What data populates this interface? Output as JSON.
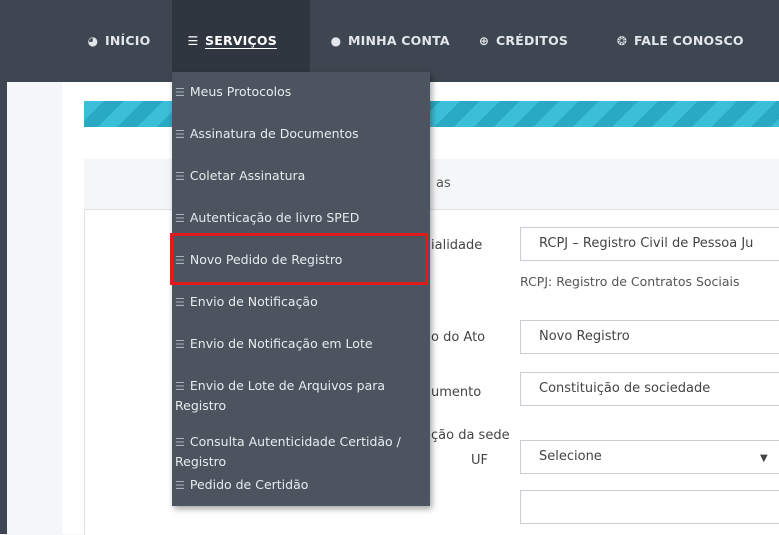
{
  "nav": {
    "items": [
      {
        "label": "INÍCIO",
        "icon": "tachometer-icon"
      },
      {
        "label": "SERVIÇOS",
        "icon": "layers-icon"
      },
      {
        "label": "MINHA CONTA",
        "icon": "user-icon"
      },
      {
        "label": "CRÉDITOS",
        "icon": "plus-circle-icon"
      },
      {
        "label": "FALE CONOSCO",
        "icon": "support-icon"
      }
    ]
  },
  "menu": {
    "items": [
      {
        "label": "Meus Protocolos"
      },
      {
        "label": "Assinatura de Documentos"
      },
      {
        "label": "Coletar Assinatura"
      },
      {
        "label": "Autenticação de livro SPED"
      },
      {
        "label": "Novo Pedido de Registro"
      },
      {
        "label": "Envio de Notificação"
      },
      {
        "label": "Envio de Notificação em Lote"
      },
      {
        "label": "Envio de Lote de Arquivos para Registro"
      },
      {
        "label": "Consulta Autenticidade Certidão / Registro"
      },
      {
        "label": "Pedido de Certidão"
      }
    ],
    "highlight_color": "#e01b1b"
  },
  "form": {
    "panel_title_fragment": "as",
    "specialty": {
      "label_fragment": "ialidade",
      "value": "RCPJ – Registro Civil de Pessoa Ju",
      "help": "RCPJ: Registro de Contratos Sociais"
    },
    "act_type": {
      "label_fragment": "o do Ato",
      "value": "Novo Registro"
    },
    "document": {
      "label_fragment": "umento",
      "value": "Constituição de sociedade"
    },
    "section_fragment": "ção da sede",
    "uf": {
      "label": "UF",
      "value": "Selecione"
    }
  },
  "colors": {
    "nav_bg": "#3e4651",
    "menu_bg": "#4b545f",
    "stripe": "#3bbfd9"
  }
}
